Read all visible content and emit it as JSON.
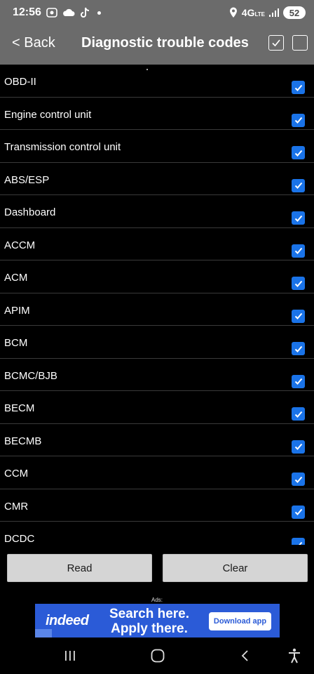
{
  "status_bar": {
    "time": "12:56",
    "network": "4G",
    "network_sub": "LTE",
    "battery": "52",
    "icons": [
      "screenshot-icon",
      "cloud-icon",
      "tiktok-icon",
      "notification-dot",
      "location-icon",
      "signal-icon"
    ]
  },
  "header": {
    "back_label": "< Back",
    "title": "Diagnostic trouble codes",
    "select_all_icon": "checkbox-checked-icon",
    "select_none_icon": "checkbox-empty-icon"
  },
  "modules": [
    {
      "label": "OBD-II",
      "checked": true
    },
    {
      "label": "Engine control unit",
      "checked": true
    },
    {
      "label": "Transmission control unit",
      "checked": true
    },
    {
      "label": "ABS/ESP",
      "checked": true
    },
    {
      "label": "Dashboard",
      "checked": true
    },
    {
      "label": "ACCM",
      "checked": true
    },
    {
      "label": "ACM",
      "checked": true
    },
    {
      "label": "APIM",
      "checked": true
    },
    {
      "label": "BCM",
      "checked": true
    },
    {
      "label": "BCMC/BJB",
      "checked": true
    },
    {
      "label": "BECM",
      "checked": true
    },
    {
      "label": "BECMB",
      "checked": true
    },
    {
      "label": "CCM",
      "checked": true
    },
    {
      "label": "CMR",
      "checked": true
    },
    {
      "label": "DCDC",
      "checked": true
    }
  ],
  "actions": {
    "read_label": "Read",
    "clear_label": "Clear"
  },
  "ad": {
    "label": "Ads:",
    "brand": "indeed",
    "headline_1": "Search here.",
    "headline_2": "Apply there.",
    "cta": "Download app"
  },
  "nav_bar": {
    "buttons": [
      "recents-icon",
      "home-icon",
      "back-icon",
      "accessibility-icon"
    ]
  },
  "colors": {
    "header_bg": "#6b6b6b",
    "checkbox_blue": "#1a73e8",
    "ad_blue": "#2b5bd7",
    "button_bg": "#d5d5d5"
  }
}
